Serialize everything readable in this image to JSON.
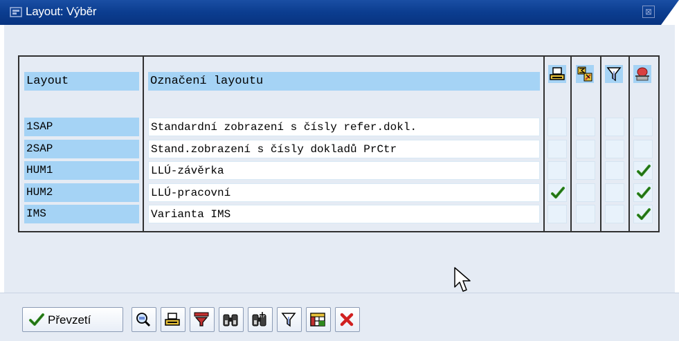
{
  "window": {
    "title": "Layout: Výběr",
    "close_label": "⊠"
  },
  "table": {
    "header": {
      "layout": "Layout",
      "description": "Označení layoutu"
    },
    "column_icons": [
      "print-icon",
      "sum-icon",
      "filter-icon",
      "user-specific-icon"
    ],
    "rows": [
      {
        "layout": "1SAP",
        "description": "Standardní zobrazení s čísly refer.dokl.",
        "flags": [
          false,
          false,
          false,
          false
        ]
      },
      {
        "layout": "2SAP",
        "description": "Stand.zobrazení s čísly dokladů PrCtr",
        "flags": [
          false,
          false,
          false,
          false
        ]
      },
      {
        "layout": "HUM1",
        "description": "LLÚ-závěrka",
        "flags": [
          false,
          false,
          false,
          true
        ]
      },
      {
        "layout": "HUM2",
        "description": "LLÚ-pracovní",
        "flags": [
          true,
          false,
          false,
          true
        ]
      },
      {
        "layout": "IMS",
        "description": "Varianta IMS",
        "flags": [
          false,
          false,
          false,
          true
        ]
      }
    ]
  },
  "toolbar": {
    "accept_label": "Převzetí",
    "buttons": [
      "accept-button",
      "find-button",
      "print-button",
      "sort-button",
      "find-text-button",
      "find-next-button",
      "filter-button",
      "grid-button",
      "cancel-button"
    ]
  },
  "colors": {
    "title_bar": "#0a3c8c",
    "header_cell": "#a5d3f5",
    "background": "#e5ebf4",
    "check": "#2f8a1e"
  }
}
